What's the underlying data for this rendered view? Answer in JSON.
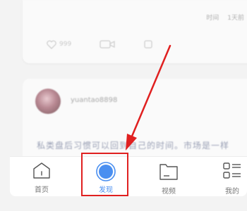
{
  "feed": {
    "card_top": {
      "time_left": "时间",
      "time_right": "1天前",
      "like_count": "999"
    },
    "card_mid": {
      "username": "yuantao8898",
      "text": "私类盘后习惯可以回到自己的时间。市场是一样"
    }
  },
  "tabbar": {
    "tabs": [
      {
        "label": "首页",
        "icon": "home-icon",
        "active": false
      },
      {
        "label": "发现",
        "icon": "discover-icon",
        "active": true
      },
      {
        "label": "视频",
        "icon": "folder-icon",
        "active": false
      },
      {
        "label": "我的",
        "icon": "menu-grid-icon",
        "active": false
      }
    ]
  },
  "colors": {
    "accent": "#4a8ff0",
    "annotation": "#e02020"
  }
}
